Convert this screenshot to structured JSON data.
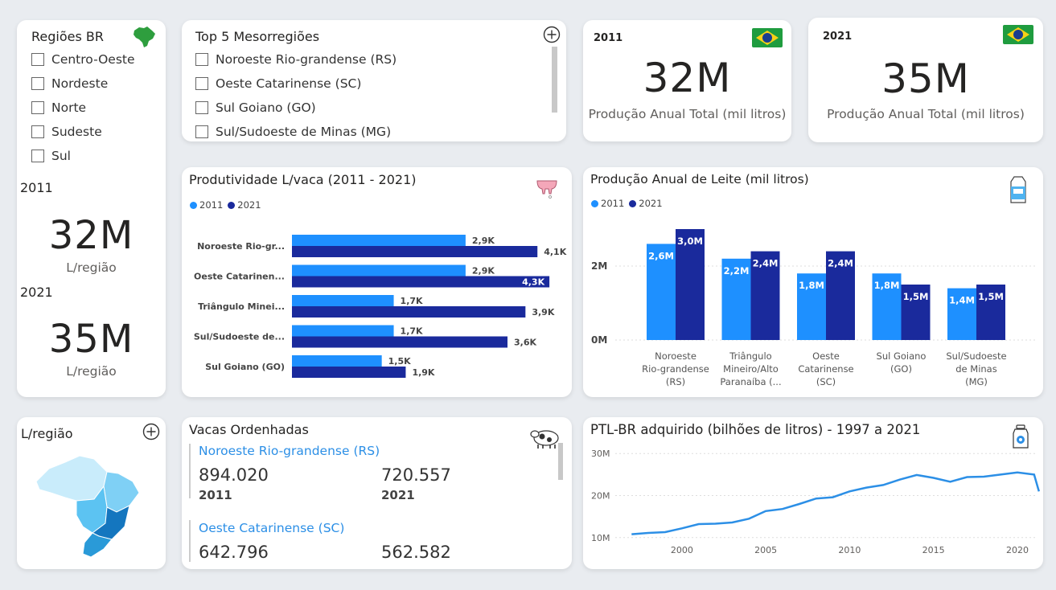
{
  "regions": {
    "title": "Regiões BR",
    "items": [
      "Centro-Oeste",
      "Nordeste",
      "Norte",
      "Sudeste",
      "Sul"
    ],
    "y2011_label": "2011",
    "y2011_value": "32M",
    "y2011_unit": "L/região",
    "y2021_label": "2021",
    "y2021_value": "35M",
    "y2021_unit": "L/região"
  },
  "meso": {
    "title": "Top 5 Mesorregiões",
    "items": [
      "Noroeste Rio-grandense (RS)",
      "Oeste Catarinense (SC)",
      "Sul Goiano (GO)",
      "Sul/Sudoeste de Minas (MG)"
    ]
  },
  "kpi1": {
    "year": "2011",
    "value": "32M",
    "label": "Produção Anual Total (mil litros)"
  },
  "kpi2": {
    "year": "2021",
    "value": "35M",
    "label": "Produção Anual Total (mil litros)"
  },
  "colors": {
    "light": "#1e90ff",
    "dark": "#1a2a9c",
    "line": "#2c8fe6",
    "map_light": "#c9ecfb",
    "map_mid": "#5cc3f2",
    "map_dark": "#1476bf"
  },
  "map": {
    "title": "L/região"
  },
  "cows": {
    "title": "Vacas Ordenhadas",
    "entries": [
      {
        "name": "Noroeste Rio-grandense (RS)",
        "v2011": "894.020",
        "v2021": "720.557",
        "y1": "2011",
        "y2": "2021"
      },
      {
        "name": "Oeste Catarinense (SC)",
        "v2011": "642.796",
        "v2021": "562.582"
      }
    ]
  },
  "chart_data": [
    {
      "type": "bar",
      "orientation": "horizontal",
      "title": "Produtividade L/vaca (2011 - 2021)",
      "categories": [
        "Noroeste Rio-gr...",
        "Oeste Catarinen...",
        "Triângulo Minei...",
        "Sul/Sudoeste de...",
        "Sul Goiano (GO)"
      ],
      "series": [
        {
          "name": "2011",
          "values": [
            2900,
            2900,
            1700,
            1700,
            1500
          ],
          "labels": [
            "2,9K",
            "2,9K",
            "1,7K",
            "1,7K",
            "1,5K"
          ]
        },
        {
          "name": "2021",
          "values": [
            4100,
            4300,
            3900,
            3600,
            1900
          ],
          "labels": [
            "4,1K",
            "4,3K",
            "3,9K",
            "3,6K",
            "1,9K"
          ]
        }
      ],
      "legend": "top-left",
      "xlim": [
        0,
        4500
      ]
    },
    {
      "type": "bar",
      "title": "Produção Anual de Leite (mil litros)",
      "categories": [
        [
          "Noroeste",
          "Rio-grandense",
          "(RS)"
        ],
        [
          "Triângulo",
          "Mineiro/Alto",
          "Paranaíba (..."
        ],
        [
          "Oeste",
          "Catarinense",
          "(SC)"
        ],
        [
          "Sul Goiano",
          "(GO)"
        ],
        [
          "Sul/Sudoeste",
          "de Minas",
          "(MG)"
        ]
      ],
      "series": [
        {
          "name": "2011",
          "values": [
            2.6,
            2.2,
            1.8,
            1.8,
            1.4
          ],
          "labels": [
            "2,6M",
            "2,2M",
            "1,8M",
            "1,8M",
            "1,4M"
          ]
        },
        {
          "name": "2021",
          "values": [
            3.0,
            2.4,
            2.4,
            1.5,
            1.5
          ],
          "labels": [
            "3,0M",
            "2,4M",
            "2,4M",
            "1,5M",
            "1,5M"
          ]
        }
      ],
      "yticks": [
        "0M",
        "2M"
      ],
      "ylim": [
        0,
        3.3
      ],
      "legend": "top-left",
      "grid": true
    },
    {
      "type": "line",
      "title": "PTL-BR adquirido (bilhões de litros) - 1997 a 2021",
      "x": [
        1997,
        1998,
        1999,
        2000,
        2001,
        2002,
        2003,
        2004,
        2005,
        2006,
        2007,
        2008,
        2009,
        2010,
        2011,
        2012,
        2013,
        2014,
        2015,
        2016,
        2017,
        2018,
        2019,
        2020,
        2021
      ],
      "values": [
        10.8,
        11.1,
        11.3,
        12.2,
        13.2,
        13.3,
        13.6,
        14.5,
        16.3,
        16.8,
        18.0,
        19.3,
        19.6,
        21.0,
        21.9,
        22.5,
        23.8,
        24.9,
        24.2,
        23.3,
        24.4,
        24.5,
        25.0,
        25.5,
        25.0
      ],
      "xticks": [
        "2000",
        "2005",
        "2010",
        "2015",
        "2020"
      ],
      "yticks": [
        "10M",
        "20M",
        "30M"
      ],
      "ylim": [
        9,
        31
      ],
      "grid": true
    }
  ]
}
